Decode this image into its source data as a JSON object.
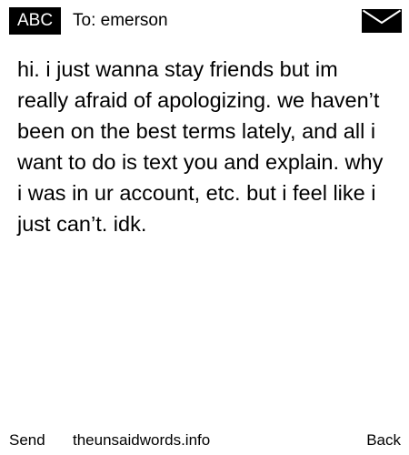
{
  "header": {
    "mode_badge": "ABC",
    "recipient": "To: emerson",
    "envelope_icon": "envelope-icon"
  },
  "message": {
    "body": "hi. i just wanna stay friends but im really afraid of apologizing. we haven’t been on the best terms lately, and all i want to do is text you and explain. why i was in ur account, etc. but i feel like i just can’t. idk."
  },
  "footer": {
    "send_label": "Send",
    "site_label": "theunsaidwords.info",
    "back_label": "Back"
  }
}
